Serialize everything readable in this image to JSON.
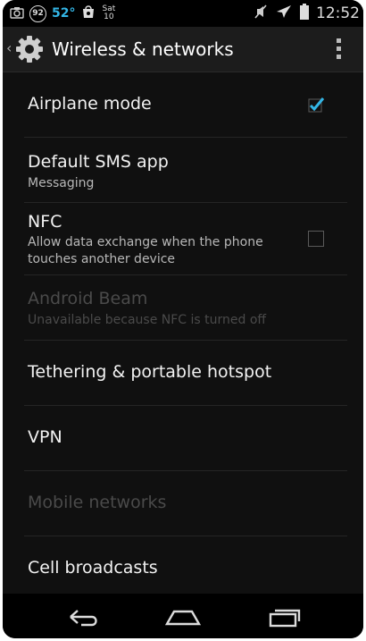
{
  "status_bar": {
    "left_icons": [
      "camera-icon",
      "circle-92-icon"
    ],
    "circle_text": "92",
    "temperature": "52°",
    "date_line1": "Sat",
    "date_line2": "10",
    "right_icons": [
      "muted-icon",
      "airplane-icon",
      "battery-icon"
    ],
    "time": "12:52"
  },
  "action_bar": {
    "up_icon": "chevron-left-icon",
    "app_icon": "gear-icon",
    "title": "Wireless & networks",
    "menu_icon": "overflow-menu-icon"
  },
  "settings": [
    {
      "title": "Airplane mode",
      "summary": "",
      "checkbox": true,
      "checked": true,
      "enabled": true
    },
    {
      "title": "Default SMS app",
      "summary": "Messaging",
      "checkbox": false,
      "enabled": true
    },
    {
      "title": "NFC",
      "summary": "Allow data exchange when the phone touches another device",
      "checkbox": true,
      "checked": false,
      "enabled": true
    },
    {
      "title": "Android Beam",
      "summary": "Unavailable because NFC is turned off",
      "checkbox": false,
      "enabled": false
    },
    {
      "title": "Tethering & portable hotspot",
      "summary": "",
      "checkbox": false,
      "enabled": true
    },
    {
      "title": "VPN",
      "summary": "",
      "checkbox": false,
      "enabled": true
    },
    {
      "title": "Mobile networks",
      "summary": "",
      "checkbox": false,
      "enabled": false
    },
    {
      "title": "Cell broadcasts",
      "summary": "",
      "checkbox": false,
      "enabled": true
    }
  ],
  "nav_bar": {
    "icons": [
      "back-icon",
      "home-icon",
      "recents-icon"
    ]
  },
  "colors": {
    "accent": "#33b5e5",
    "background": "#101010",
    "text_primary": "#f2f2f2",
    "text_secondary": "#b8b8b8",
    "text_disabled": "#4a4a4a"
  }
}
